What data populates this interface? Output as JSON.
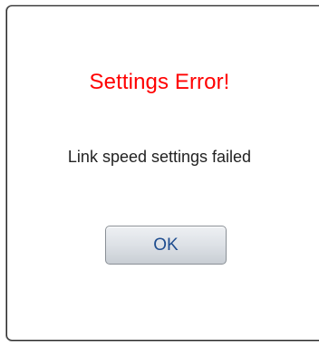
{
  "dialog": {
    "title": "Settings Error!",
    "message": "Link speed settings failed",
    "ok_label": "OK"
  },
  "colors": {
    "title": "#ff0000",
    "message": "#222222",
    "button_text": "#1f4d8f",
    "background": "#ffffff"
  }
}
